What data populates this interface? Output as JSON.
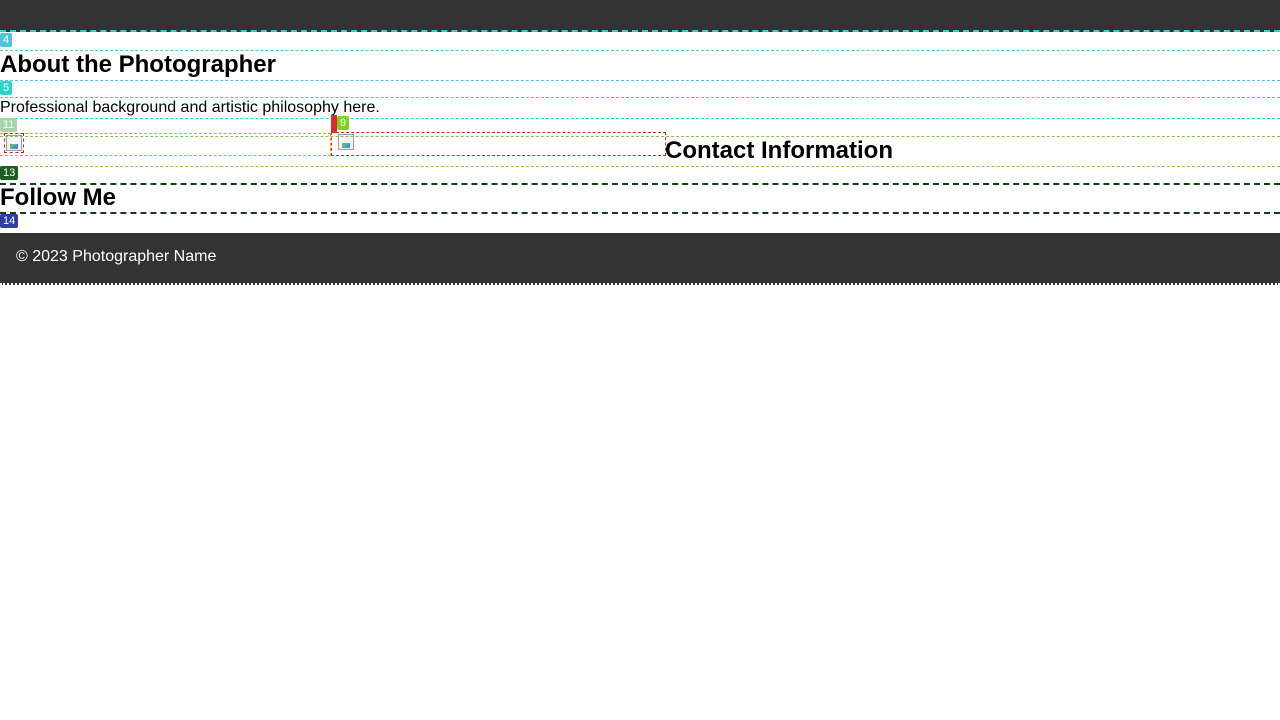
{
  "about": {
    "heading": "About the Photographer",
    "text": "Professional background and artistic philosophy here."
  },
  "contact": {
    "heading": "Contact Information"
  },
  "social": {
    "heading": "Follow Me"
  },
  "footer": {
    "copyright": "© 2023 Photographer Name"
  },
  "badges": {
    "b4": "4",
    "b5": "5",
    "b9": "9",
    "b11": "11",
    "b13": "13",
    "b14": "14"
  },
  "colors": {
    "bar": "#333333",
    "badge4": "#4fc3e0",
    "badge5": "#2fd4c9",
    "badge9": "#7ed321",
    "badge11": "#a5d6a7",
    "badge13": "#1b5e20",
    "badge14": "#303f9f"
  }
}
